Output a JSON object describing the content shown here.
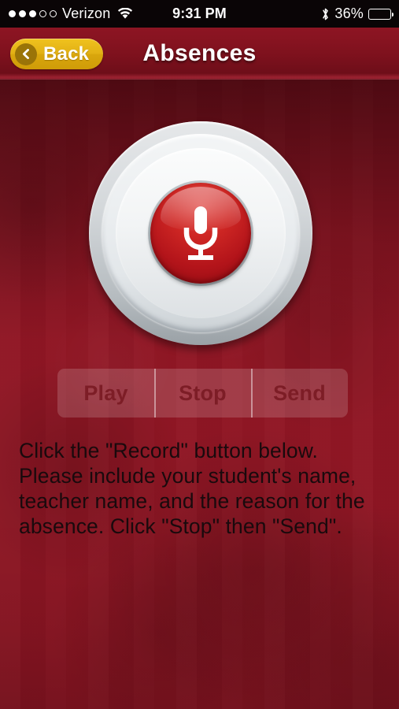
{
  "status_bar": {
    "carrier": "Verizon",
    "signal_bars_filled": 3,
    "signal_bars_total": 5,
    "wifi_icon": "wifi-icon",
    "time": "9:31 PM",
    "bluetooth_icon": "bluetooth-icon",
    "battery_percent_label": "36%",
    "battery_level": 36,
    "background_color": "#0a0506",
    "text_color": "#ffffff"
  },
  "nav_bar": {
    "title": "Absences",
    "back_label": "Back",
    "back_icon": "chevron-left-icon",
    "back_button_color": "#e2b115",
    "background_color": "#861320",
    "title_color": "#ffffff"
  },
  "main": {
    "record_button": {
      "icon": "microphone-icon",
      "inner_color": "#c1201f",
      "ring_color": "#d3d7da"
    },
    "transport": {
      "segments": [
        {
          "label": "Play",
          "name": "play-segment"
        },
        {
          "label": "Stop",
          "name": "stop-segment"
        },
        {
          "label": "Send",
          "name": "send-segment"
        }
      ],
      "text_color": "#7d1d26",
      "enabled": false
    },
    "instructions": "Click the \"Record\" button below. Please include your student's name, teacher name, and the reason for the absence. Click \"Stop\" then \"Send\".",
    "background_color": "#901624",
    "instructions_color": "#190a0d"
  }
}
